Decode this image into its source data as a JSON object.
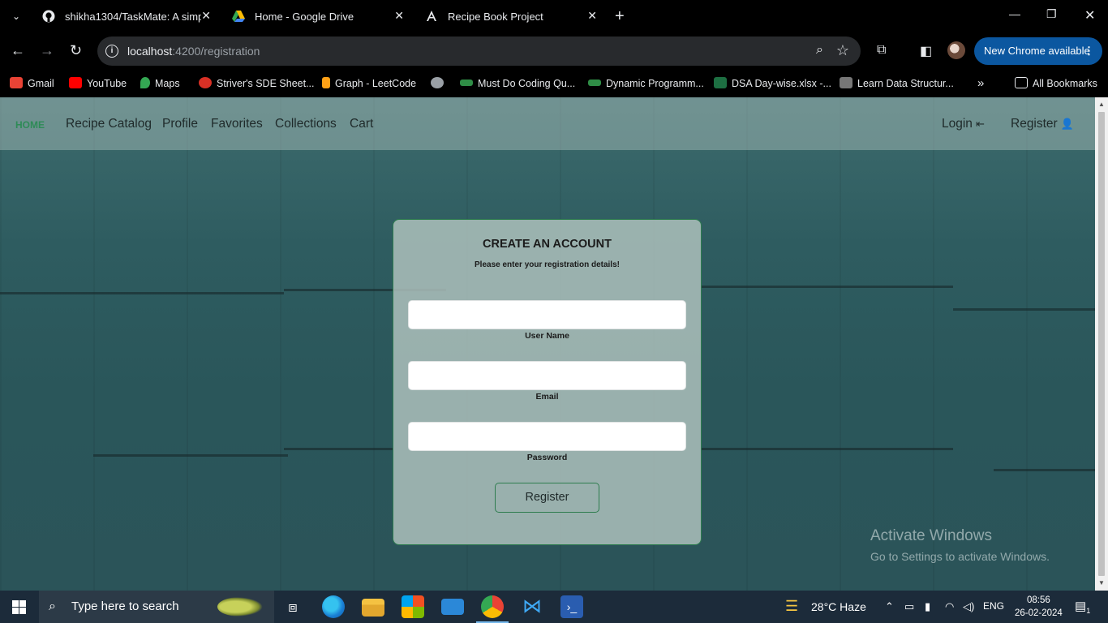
{
  "browser": {
    "tabs": [
      {
        "title": "shikha1304/TaskMate: A simple",
        "icon": "github-icon"
      },
      {
        "title": "Home - Google Drive",
        "icon": "google-drive-icon"
      },
      {
        "title": "Recipe Book Project",
        "icon": "angular-icon"
      }
    ],
    "address": {
      "host": "localhost",
      "path": ":4200/registration"
    },
    "update_button": "New Chrome available",
    "bookmarks": [
      {
        "label": "Gmail",
        "color": "#ea4335"
      },
      {
        "label": "YouTube",
        "color": "#ff0000"
      },
      {
        "label": "Maps",
        "color": "#34a853"
      },
      {
        "label": "Striver's SDE Sheet...",
        "color": "#d93025"
      },
      {
        "label": "Graph - LeetCode",
        "color": "#ffa116"
      },
      {
        "label": "",
        "color": "#9aa0a6"
      },
      {
        "label": "Must Do Coding Qu...",
        "color": "#2f8d46"
      },
      {
        "label": "Dynamic Programm...",
        "color": "#2f8d46"
      },
      {
        "label": "DSA Day-wise.xlsx -...",
        "color": "#1d6f42"
      },
      {
        "label": "Learn Data Structur...",
        "color": "#777777"
      }
    ],
    "all_bookmarks": "All Bookmarks"
  },
  "site": {
    "nav": {
      "home": "HOME",
      "links": [
        "Recipe Catalog",
        "Profile",
        "Favorites",
        "Collections",
        "Cart"
      ],
      "login": "Login",
      "register": "Register"
    },
    "form": {
      "title": "CREATE AN ACCOUNT",
      "subtitle": "Please enter your registration details!",
      "fields": [
        {
          "label": "User Name",
          "value": ""
        },
        {
          "label": "Email",
          "value": ""
        },
        {
          "label": "Password",
          "value": ""
        }
      ],
      "submit": "Register"
    },
    "accent_color": "#2e8b57"
  },
  "watermark": {
    "line1": "Activate Windows",
    "line2": "Go to Settings to activate Windows."
  },
  "taskbar": {
    "search_placeholder": "Type here to search",
    "weather": "28°C  Haze",
    "language": "ENG",
    "time": "08:56",
    "date": "26-02-2024",
    "notifications": "1"
  }
}
